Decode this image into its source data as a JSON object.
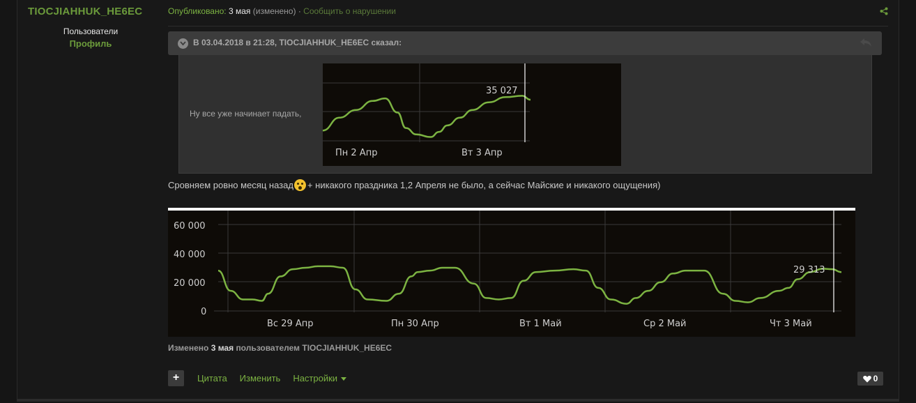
{
  "author": {
    "name": "TIOCJIAHHUK_HE6EC",
    "group": "Пользователи",
    "profile_link": "Профиль"
  },
  "meta": {
    "published_label": "Опубликовано:",
    "date": "3 мая",
    "edited_flag": "(изменено)",
    "separator": "·",
    "report_link": "Сообщить о нарушении",
    "share_icon": "share-icon"
  },
  "quote": {
    "header": "В 03.04.2018 в 21:28, TIOCJIAHHUK_HE6EC сказал:",
    "text": "Ну все уже начинает падать,"
  },
  "post_text": {
    "before_emoji": "Сровняем ровно месяц назад",
    "after_emoji": " + никакого праздника 1,2 Апреля не было, а сейчас Майские и никакого ощущения)"
  },
  "edited_note": {
    "prefix": "Изменено",
    "date": "3 мая",
    "middle": "пользователем",
    "user": "TIOCJIAHHUK_HE6EC"
  },
  "actions": {
    "plus": "+",
    "quote": "Цитата",
    "edit": "Изменить",
    "settings": "Настройки"
  },
  "likes": {
    "count": "0"
  },
  "colors": {
    "accent": "#7cb342",
    "line": "#7cb342",
    "chart_bg": "#0e0b07"
  },
  "chart_data": [
    {
      "type": "line",
      "x_ticks": [
        "Пн 2 Апр",
        "Вт 3 Апр"
      ],
      "marker_label": "35 027",
      "x": [
        0,
        0.08,
        0.16,
        0.24,
        0.3,
        0.36,
        0.4,
        0.45,
        0.52,
        0.56,
        0.6,
        0.66,
        0.72,
        0.8,
        0.88,
        0.96,
        1.0
      ],
      "y": [
        8,
        18,
        24,
        31,
        33,
        22,
        10,
        5,
        3,
        7,
        12,
        18,
        24,
        30,
        34,
        35,
        32
      ],
      "ylim": [
        0,
        45
      ]
    },
    {
      "type": "line",
      "y_ticks": [
        "60 000",
        "40 000",
        "20 000",
        "0"
      ],
      "x_ticks": [
        "Вс 29 Апр",
        "Пн 30 Апр",
        "Вт 1 Май",
        "Ср 2 Май",
        "Чт 3 Май"
      ],
      "marker_label": "29 313",
      "x": [
        0,
        0.02,
        0.04,
        0.055,
        0.07,
        0.08,
        0.1,
        0.12,
        0.14,
        0.16,
        0.18,
        0.2,
        0.22,
        0.24,
        0.27,
        0.29,
        0.31,
        0.32,
        0.34,
        0.36,
        0.38,
        0.41,
        0.43,
        0.45,
        0.47,
        0.49,
        0.51,
        0.54,
        0.57,
        0.59,
        0.61,
        0.63,
        0.655,
        0.67,
        0.69,
        0.71,
        0.73,
        0.75,
        0.78,
        0.81,
        0.83,
        0.85,
        0.87,
        0.9,
        0.915,
        0.93,
        0.95,
        0.97,
        0.985,
        1.0
      ],
      "y": [
        28000,
        14000,
        8000,
        8000,
        7000,
        12000,
        24000,
        29000,
        30000,
        31000,
        31000,
        30000,
        15000,
        8000,
        7000,
        12000,
        24000,
        27000,
        28000,
        30000,
        30000,
        19000,
        9000,
        8000,
        9000,
        21000,
        27000,
        28000,
        29000,
        28000,
        16000,
        8000,
        5000,
        9000,
        14000,
        20000,
        26000,
        28000,
        28000,
        12000,
        7000,
        6000,
        9000,
        14000,
        16000,
        22000,
        27000,
        29313,
        29000,
        27000
      ],
      "ylim": [
        0,
        60000
      ]
    }
  ]
}
